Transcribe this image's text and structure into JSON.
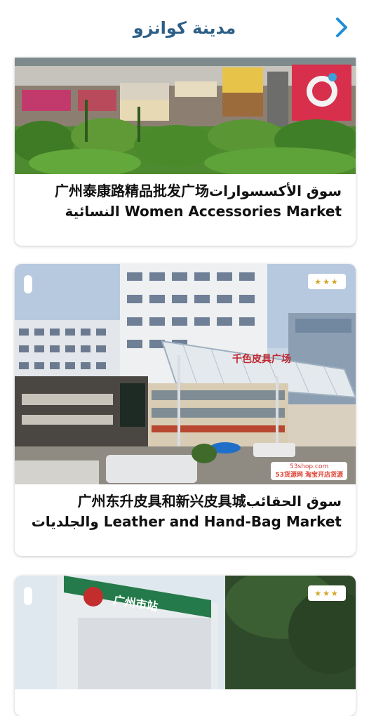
{
  "header": {
    "title": "مدينة كوانزو"
  },
  "cards": [
    {
      "title": "سوق الأكسسوارات广州泰康路精品批发广场 Women Accessories Market النسائية"
    },
    {
      "rating_stars": "★★★",
      "title": "سوق الحقائب广州东升皮具和新兴皮具城 Leather and Hand-Bag Market والجلديات",
      "image_sign": "千色皮具广场",
      "watermark_line1": "53shop.com",
      "watermark_line2": "53货源网 淘宝开店货源"
    },
    {
      "rating_stars": "★★★",
      "image_sign": "广州市站"
    }
  ],
  "colors": {
    "header_title": "#2c5f86",
    "back_arrow": "#1e8fd6",
    "stars": "#d4a520"
  }
}
